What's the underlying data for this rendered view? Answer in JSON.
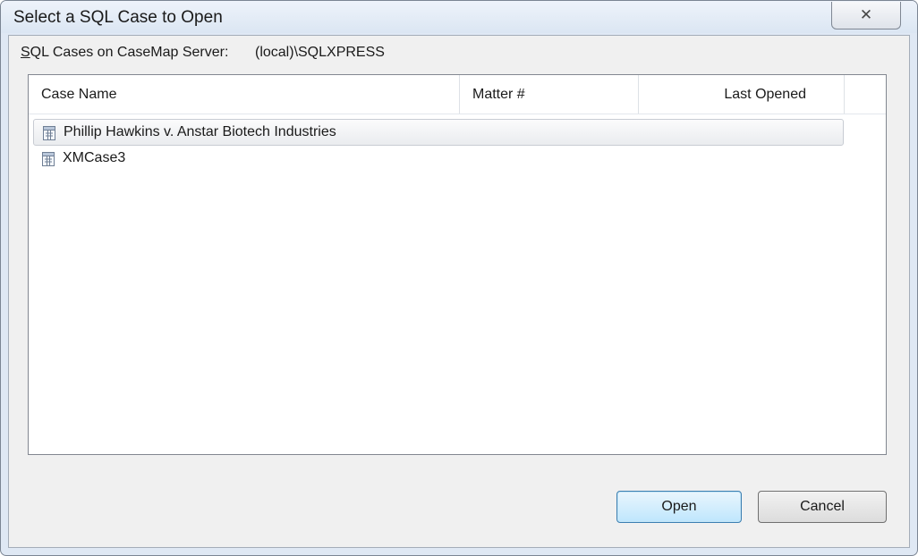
{
  "window": {
    "title": "Select a SQL Case to Open"
  },
  "server": {
    "label_mnemonic": "S",
    "label_rest": "QL Cases on CaseMap Server:",
    "value": "(local)\\SQLXPRESS"
  },
  "list": {
    "columns": [
      "Case Name",
      "Matter #",
      "Last Opened"
    ],
    "rows": [
      {
        "name": "Phillip Hawkins v. Anstar Biotech Industries",
        "matter": "",
        "last_opened": "",
        "selected": true
      },
      {
        "name": "XMCase3",
        "matter": "",
        "last_opened": "",
        "selected": false
      }
    ]
  },
  "buttons": {
    "open": "Open",
    "cancel": "Cancel"
  },
  "icons": {
    "close": "close-icon",
    "case": "database-case-icon"
  }
}
